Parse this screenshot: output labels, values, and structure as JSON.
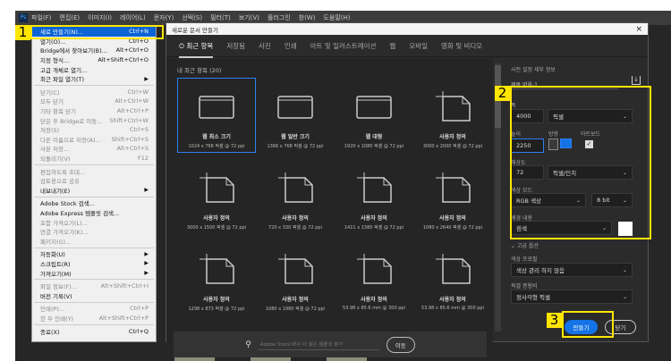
{
  "menubar": [
    "파일(F)",
    "편집(E)",
    "이미지(I)",
    "레이어(L)",
    "문자(Y)",
    "선택(S)",
    "필터(T)",
    "보기(V)",
    "플러그인",
    "창(W)",
    "도움말(H)"
  ],
  "file_menu": [
    {
      "label": "새로 만들기(N)...",
      "shortcut": "Ctrl+N",
      "state": "selected"
    },
    {
      "label": "열기(O)...",
      "shortcut": "Ctrl+O"
    },
    {
      "label": "Bridge에서 찾아보기(B)...",
      "shortcut": "Alt+Ctrl+O"
    },
    {
      "label": "지정 형식...",
      "shortcut": "Alt+Shift+Ctrl+O"
    },
    {
      "label": "고급 개체로 열기...",
      "shortcut": ""
    },
    {
      "label": "최근 파일 열기(T)",
      "shortcut": "",
      "submenu": true,
      "sep_after": true
    },
    {
      "label": "닫기(C)",
      "shortcut": "Ctrl+W",
      "disabled": true
    },
    {
      "label": "모두 닫기",
      "shortcut": "Alt+Ctrl+W",
      "disabled": true
    },
    {
      "label": "기타 항목 닫기",
      "shortcut": "Alt+Ctrl+P",
      "disabled": true
    },
    {
      "label": "닫은 후 Bridge로 이동...",
      "shortcut": "Shift+Ctrl+W",
      "disabled": true
    },
    {
      "label": "저장(S)",
      "shortcut": "Ctrl+S",
      "disabled": true
    },
    {
      "label": "다른 이름으로 저장(A)...",
      "shortcut": "Shift+Ctrl+S",
      "disabled": true
    },
    {
      "label": "사본 저장...",
      "shortcut": "Alt+Ctrl+S",
      "disabled": true
    },
    {
      "label": "되돌리기(V)",
      "shortcut": "F12",
      "disabled": true,
      "sep_after": true
    },
    {
      "label": "편집하도록 초대...",
      "shortcut": "",
      "disabled": true
    },
    {
      "label": "검토용으로 공유",
      "shortcut": "",
      "disabled": true
    },
    {
      "label": "내보내기(E)",
      "shortcut": "",
      "submenu": true,
      "sep_after": true
    },
    {
      "label": "Adobe Stock 검색...",
      "shortcut": ""
    },
    {
      "label": "Adobe Express 템플릿 검색...",
      "shortcut": ""
    },
    {
      "label": "포함 가져오기(L)...",
      "shortcut": "",
      "disabled": true
    },
    {
      "label": "연결 가져오기(K)...",
      "shortcut": "",
      "disabled": true
    },
    {
      "label": "패키지(G)...",
      "shortcut": "",
      "disabled": true,
      "sep_after": true
    },
    {
      "label": "자동화(U)",
      "shortcut": "",
      "submenu": true
    },
    {
      "label": "스크립트(R)",
      "shortcut": "",
      "submenu": true
    },
    {
      "label": "가져오기(M)",
      "shortcut": "",
      "submenu": true,
      "sep_after": true
    },
    {
      "label": "파일 정보(F)...",
      "shortcut": "Alt+Shift+Ctrl+I",
      "disabled": true
    },
    {
      "label": "버전 기록(V)",
      "shortcut": "",
      "sep_after": true
    },
    {
      "label": "인쇄(P)...",
      "shortcut": "Ctrl+P",
      "disabled": true
    },
    {
      "label": "한 부 인쇄(Y)",
      "shortcut": "Alt+Shift+Ctrl+P",
      "disabled": true,
      "sep_after": true
    },
    {
      "label": "종료(X)",
      "shortcut": "Ctrl+Q"
    }
  ],
  "dialog": {
    "title": "새로운 문서 만들기",
    "close": "×",
    "tabs": [
      "최근 항목",
      "저장됨",
      "사진",
      "인쇄",
      "아트 및 일러스트레이션",
      "웹",
      "모바일",
      "영화 및 비디오"
    ],
    "recent_label": "내 최근 항목  (20)",
    "presets": [
      {
        "name": "웹 최소 크기",
        "dims": "1024 x 768 픽셀 @ 72 ppi",
        "icon": "web"
      },
      {
        "name": "웹 일반 크기",
        "dims": "1366 x 768 픽셀 @ 72 ppi",
        "icon": "web"
      },
      {
        "name": "웹 대형",
        "dims": "1920 x 1080 픽셀 @ 72 ppi",
        "icon": "web"
      },
      {
        "name": "사용자 정의",
        "dims": "3000 x 2000 픽셀 @ 72 ppi",
        "icon": "doc"
      },
      {
        "name": "사용자 정의",
        "dims": "3000 x 1500 픽셀 @ 72 ppi",
        "icon": "doc"
      },
      {
        "name": "사용자 정의",
        "dims": "720 x 330 픽셀 @ 72 ppi",
        "icon": "doc"
      },
      {
        "name": "사용자 정의",
        "dims": "1411 x 1380 픽셀 @ 72 ppi",
        "icon": "doc"
      },
      {
        "name": "사용자 정의",
        "dims": "1080 x 2640 픽셀 @ 72 ppi",
        "icon": "doc"
      },
      {
        "name": "사용자 정의",
        "dims": "1298 x 873 픽셀 @ 72 ppi",
        "icon": "doc"
      },
      {
        "name": "사용자 정의",
        "dims": "1080 x 1980 픽셀 @ 72 ppi",
        "icon": "doc"
      },
      {
        "name": "사용자 정의",
        "dims": "53.98 x 85.6 mm @ 300 ppi",
        "icon": "doc"
      },
      {
        "name": "사용자 정의",
        "dims": "53.98 x 85.6 mm @ 300 ppi",
        "icon": "doc"
      }
    ],
    "stock_placeholder": "Adobe Stock에서 더 많은 템플릿 찾기",
    "stock_go": "이동",
    "details": {
      "header": "사전 설정 세부 정보",
      "doc_name": "제목 없음-1",
      "width_label": "폭",
      "width": "4000",
      "width_unit": "픽셀",
      "height_label": "높이",
      "height": "2250",
      "orientation_label": "방향",
      "artboard_label": "아트보드",
      "resolution_label": "해상도",
      "resolution": "72",
      "resolution_unit": "픽셀/인치",
      "color_mode_label": "색상 모드",
      "color_mode": "RGB 색상",
      "bit_depth": "8 bit",
      "background_label": "배경 내용",
      "background": "흰색",
      "advanced": "고급 옵션",
      "profile_label": "색상 프로필",
      "profile": "색상 관리 하지 않음",
      "pixel_ratio_label": "픽셀 종횡비",
      "pixel_ratio": "정사각형 픽셀",
      "create": "만들기",
      "close": "닫기"
    }
  },
  "annotations": [
    "1",
    "2",
    "3"
  ],
  "colors": {
    "accent": "#1473e6",
    "highlight": "#ffe600"
  }
}
